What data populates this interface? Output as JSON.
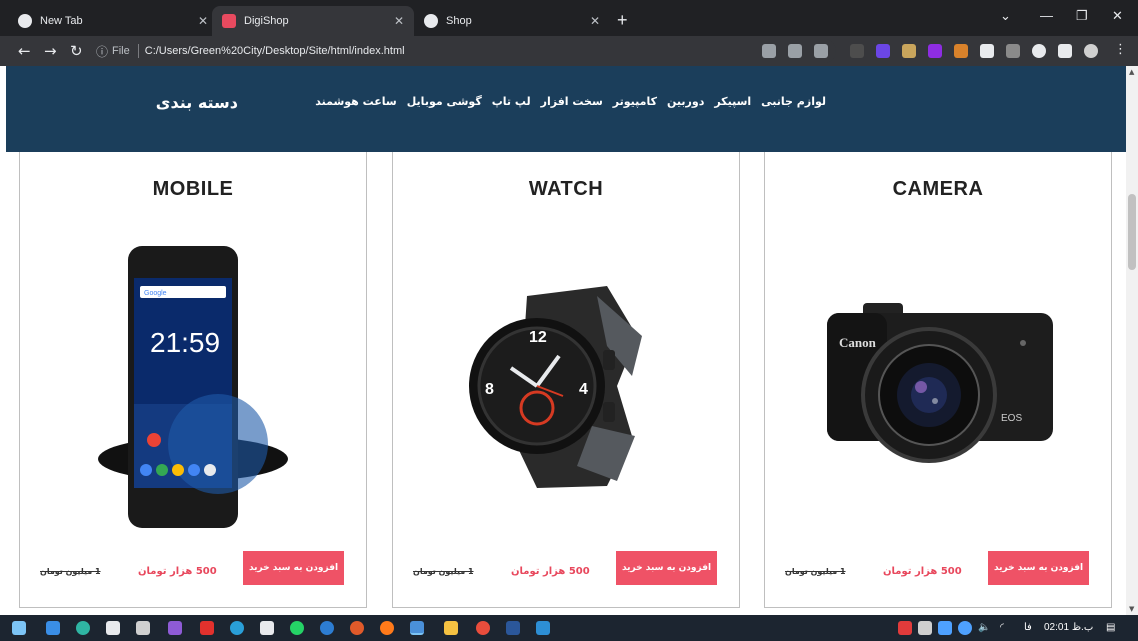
{
  "browser": {
    "tabs": [
      {
        "title": "New Tab",
        "favicon": "chrome-icon",
        "active": false
      },
      {
        "title": "DigiShop",
        "favicon": "digishop-icon",
        "active": true
      },
      {
        "title": "Shop",
        "favicon": "chrome-icon",
        "active": false
      }
    ],
    "new_tab": "+",
    "address": {
      "scheme_label": "File",
      "url": "C:/Users/Green%20City/Desktop/Site/html/index.html"
    }
  },
  "category_nav": {
    "title": "دسته بندی",
    "items": [
      "لوازم جانبی",
      "اسپیکر",
      "دوربین",
      "کامپیوتر",
      "سخت افزار",
      "لپ تاپ",
      "گوشی موبایل",
      "ساعت هوشمند"
    ]
  },
  "products": [
    {
      "name": "MOBILE",
      "buy_label": "افزودن به سبد خرید",
      "price_new": "500 هزار تومان",
      "price_old": "1 میلیون تومان",
      "icon": "phone-icon"
    },
    {
      "name": "WATCH",
      "buy_label": "افزودن به سبد خرید",
      "price_new": "500 هزار تومان",
      "price_old": "1 میلیون تومان",
      "icon": "watch-icon"
    },
    {
      "name": "CAMERA",
      "buy_label": "افزودن به سبد خرید",
      "price_new": "500 هزار تومان",
      "price_old": "1 میلیون تومان",
      "icon": "camera-icon"
    }
  ],
  "phone_screen": {
    "time": "21:59",
    "search_brand": "Google"
  },
  "watch_face": {
    "numerals": [
      "12",
      "8",
      "4"
    ]
  },
  "camera": {
    "brand": "Canon",
    "model": "EOS"
  },
  "taskbar": {
    "clock": "02:01 ب.ظ",
    "lang": "فا"
  },
  "colors": {
    "nav_bg": "#1b3e5b",
    "buy_button": "#ef5266",
    "price_new": "#e8475c"
  }
}
